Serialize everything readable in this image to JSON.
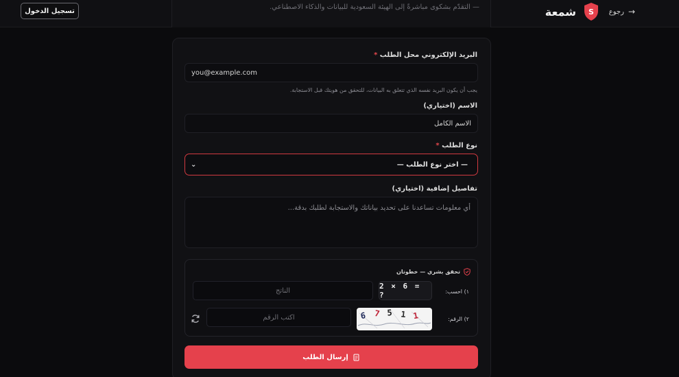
{
  "header": {
    "brand": "شمعة",
    "brand_letter": "S",
    "back": "رجوع",
    "note": "— التقدّم بشكوى مباشرةً إلى الهيئة السعودية للبيانات والذكاء الاصطناعي.",
    "login": "تسجيل الدخول"
  },
  "form": {
    "email": {
      "label": "البريد الإلكتروني محل الطلب",
      "required": "*",
      "value": "you@example.com",
      "hint": "يجب أن يكون البريد نفسه الذي تتعلق به البيانات، للتحقق من هويتك قبل الاستجابة."
    },
    "name": {
      "label": "الاسم (اختياري)",
      "placeholder": "الاسم الكامل"
    },
    "request_type": {
      "label": "نوع الطلب",
      "required": "*",
      "selected": "— اختر نوع الطلب —"
    },
    "details": {
      "label": "تفاصيل إضافية (اختياري)",
      "placeholder": "أي معلومات تساعدنا على تحديد بياناتك والاستجابة لطلبك بدقة..."
    },
    "captcha": {
      "title": "تحقق بشري — خطوتان",
      "step1_label": "١) احسب:",
      "equation": "2 × 6 = ?",
      "step1_placeholder": "الناتج",
      "step2_label": "٢) الرقم:",
      "digits": [
        "6",
        "7",
        "5",
        "1",
        "1"
      ],
      "step2_placeholder": "اكتب الرقم"
    },
    "submit": "إرسال الطلب"
  },
  "colors": {
    "accent": "#e5414c",
    "background": "#0b0b0d",
    "card": "#111114"
  },
  "icons": {
    "brand": "shield-icon",
    "back": "arrow-right-icon",
    "captcha": "shield-check-icon",
    "refresh": "refresh-icon",
    "submit": "send-document-icon",
    "select": "chevron-down-icon"
  }
}
